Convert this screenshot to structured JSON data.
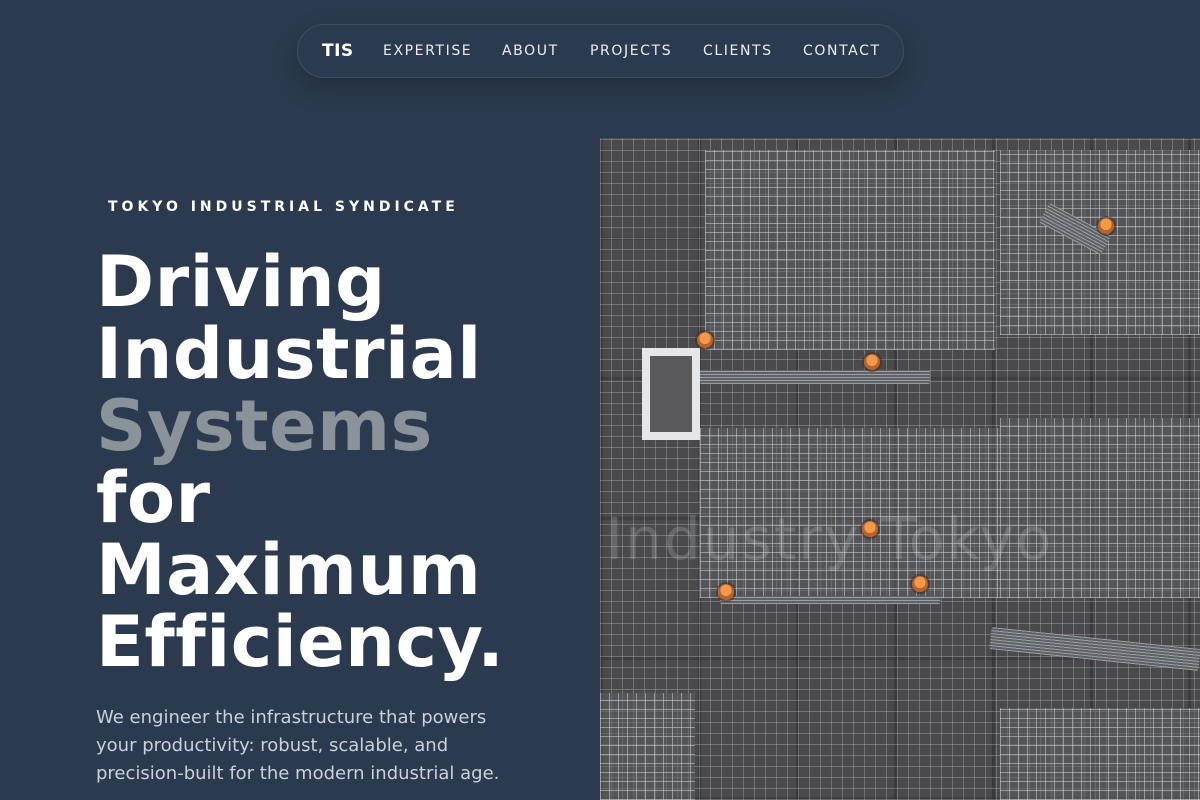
{
  "nav": {
    "logo": "TIS",
    "links": [
      "EXPERTISE",
      "ABOUT",
      "PROJECTS",
      "CLIENTS",
      "CONTACT"
    ]
  },
  "hero": {
    "eyebrow": "TOKYO INDUSTRIAL SYNDICATE",
    "headline": [
      "Driving",
      "Industrial",
      "Systems",
      "for",
      "Maximum",
      "Efficiency."
    ],
    "lede": "We engineer the infrastructure that powers your productivity: robust, scalable, and precision-built for the modern industrial age.",
    "image_watermark": "Industry Tokyo"
  },
  "colors": {
    "background": "#2b3a4e",
    "heading": "#ffffff",
    "heading_muted": "#8a9399",
    "body_text": "#c9d1db"
  }
}
